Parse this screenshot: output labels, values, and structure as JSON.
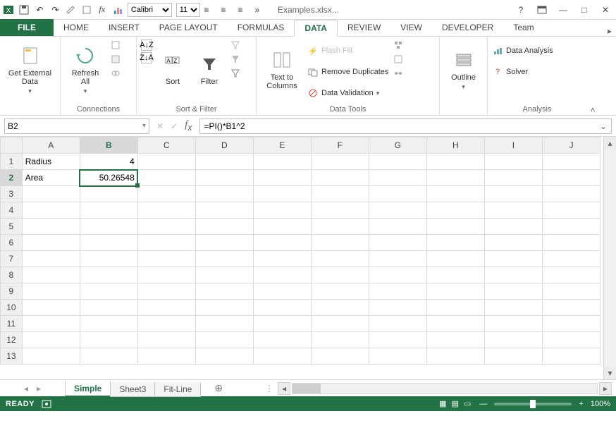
{
  "title": {
    "filename": "Examples.xlsx..."
  },
  "qat": {
    "font_name": "Calibri",
    "font_size": "11"
  },
  "tabs": {
    "file": "FILE",
    "items": [
      "HOME",
      "INSERT",
      "PAGE LAYOUT",
      "FORMULAS",
      "DATA",
      "REVIEW",
      "VIEW",
      "DEVELOPER",
      "Team"
    ],
    "active": "DATA"
  },
  "ribbon": {
    "group1": {
      "btn": "Get External\nData",
      "label": ""
    },
    "group2": {
      "btn": "Refresh\nAll",
      "label": "Connections"
    },
    "group3": {
      "sort": "Sort",
      "filter": "Filter",
      "label": "Sort & Filter"
    },
    "group4": {
      "btn": "Text to\nColumns",
      "flash": "Flash Fill",
      "dup": "Remove Duplicates",
      "valid": "Data Validation",
      "label": "Data Tools"
    },
    "group5": {
      "btn": "Outline"
    },
    "group6": {
      "da": "Data Analysis",
      "solver": "Solver",
      "label": "Analysis"
    }
  },
  "fx": {
    "name_box": "B2",
    "formula": "=PI()*B1^2"
  },
  "columns": [
    "A",
    "B",
    "C",
    "D",
    "E",
    "F",
    "G",
    "H",
    "I",
    "J"
  ],
  "rows": [
    "1",
    "2",
    "3",
    "4",
    "5",
    "6",
    "7",
    "8",
    "9",
    "10",
    "11",
    "12",
    "13"
  ],
  "cells": {
    "A1": "Radius",
    "B1": "4",
    "A2": "Area",
    "B2": "50.26548"
  },
  "selected": "B2",
  "sheet_tabs": {
    "active": "Simple",
    "others": [
      "Sheet3",
      "Fit-Line"
    ]
  },
  "status": {
    "text": "READY",
    "zoom": "100%"
  }
}
